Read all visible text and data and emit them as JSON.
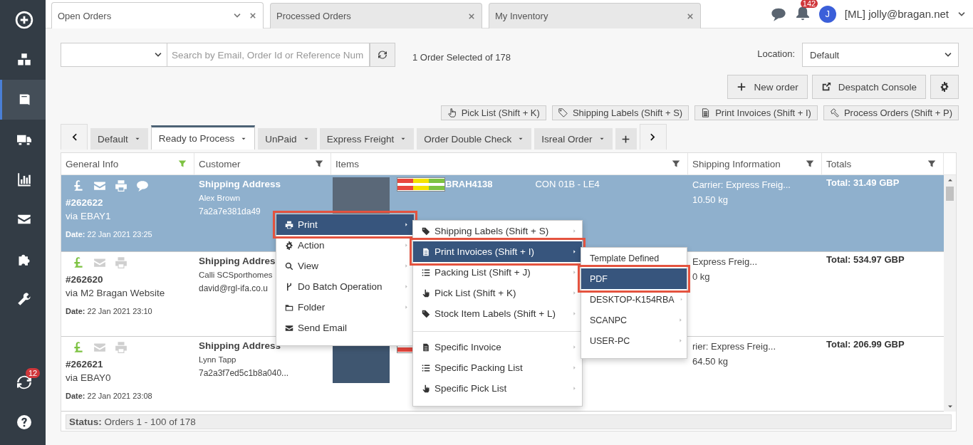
{
  "sidebar": {
    "items": [
      {
        "selected": false
      },
      {
        "selected": false
      },
      {
        "selected": true
      },
      {
        "selected": false
      },
      {
        "selected": false
      },
      {
        "selected": false
      },
      {
        "selected": false
      },
      {
        "selected": false
      },
      {
        "selected": false,
        "badge": "12"
      },
      {
        "selected": false
      }
    ]
  },
  "tabs": [
    {
      "label": "Open Orders",
      "selected": true
    },
    {
      "label": "Processed Orders",
      "selected": false
    },
    {
      "label": "My Inventory",
      "selected": false
    }
  ],
  "header": {
    "notifications_badge": "142",
    "avatar_letter": "J",
    "user": "[ML] jolly@bragan.net"
  },
  "toolbar": {
    "search_placeholder": "Search by Email, Order Id or Reference Num",
    "selection_text": "1 Order Selected of 178",
    "location_label": "Location:",
    "location_value": "Default",
    "buttons": [
      "New order",
      "Despatch Console"
    ],
    "quick_buttons": [
      "Pick List (Shift + K)",
      "Shipping Labels (Shift + S)",
      "Print Invoices (Shift + I)",
      "Process Orders (Shift + P)"
    ]
  },
  "views": [
    {
      "label": "Default",
      "selected": false
    },
    {
      "label": "Ready to Process",
      "selected": true
    },
    {
      "label": "UnPaid",
      "selected": false
    },
    {
      "label": "Express Freight",
      "selected": false
    },
    {
      "label": "Order Double Check",
      "selected": false
    },
    {
      "label": "Isreal Order",
      "selected": false
    }
  ],
  "table": {
    "columns": [
      {
        "label": "General Info",
        "filtered": true
      },
      {
        "label": "Customer",
        "filtered": false
      },
      {
        "label": "Items",
        "filtered": false
      },
      {
        "label": "Shipping Information",
        "filtered": false
      },
      {
        "label": "Totals",
        "filtered": false
      }
    ],
    "rows": [
      {
        "selected": true,
        "note": true,
        "order": "#262622",
        "channel": "via EBAY1",
        "date": "**Date:** 22 Jan 2021 23:25",
        "customer": [
          "Shipping Address",
          "Alex Brown",
          "7a2a7e381da49"
        ],
        "items": {
          "photo": true,
          "stock_bar": true,
          "sku": "BRAH4138",
          "location": "CON 01B - LE4"
        },
        "shipping": [
          "Carrier: Express Freig...",
          "10.50 kg"
        ],
        "total": "Total: 31.49 GBP"
      },
      {
        "selected": false,
        "note": false,
        "order": "#262620",
        "channel": "via M2 Bragan Website",
        "date": "**Date:** 22 Jan 2021 23:10",
        "customer": [
          "Shipping Addres",
          "Calli SCSporthomes",
          "david@rgl-ifa.co.u"
        ],
        "shipping": [
          "Express Freig...",
          "0 kg"
        ],
        "total": "Total: 534.97 GBP"
      },
      {
        "selected": false,
        "note": false,
        "order": "#262621",
        "channel": "via EBAY0",
        "date": "**Date:** 22 Jan 2021 23:08",
        "customer": [
          "Shipping Address",
          "Lynn Tapp",
          "7a2a3f7ed5c1b8a040..."
        ],
        "items": {
          "photo": true,
          "stock_bar": true
        },
        "shipping": [
          "rier: Express Freig...",
          "64.50 kg"
        ],
        "total": "Total: 206.99 GBP"
      }
    ],
    "status": "**Status:** Orders 1 - 100 of 178"
  },
  "context_menu": [
    {
      "label": "Print",
      "selected": true,
      "submenu": true
    },
    {
      "label": "Action",
      "selected": false,
      "submenu": true
    },
    {
      "label": "View",
      "selected": false,
      "submenu": true
    },
    {
      "label": "Do Batch Operation",
      "selected": false,
      "submenu": true
    },
    {
      "label": "Folder",
      "selected": false,
      "submenu": true
    },
    {
      "label": "Send Email",
      "selected": false,
      "submenu": false
    }
  ],
  "print_menu": [
    [
      {
        "label": "Shipping Labels (Shift + S)",
        "selected": false
      },
      {
        "label": "Print Invoices (Shift + I)",
        "selected": true
      },
      {
        "label": "Packing List (Shift + J)",
        "selected": false
      },
      {
        "label": "Pick List (Shift + K)",
        "selected": false
      },
      {
        "label": "Stock Item Labels (Shift + L)",
        "selected": false
      }
    ],
    [
      {
        "label": "Specific Invoice",
        "selected": false
      },
      {
        "label": "Specific Packing List",
        "selected": false
      },
      {
        "label": "Specific Pick List",
        "selected": false
      }
    ]
  ],
  "printer_menu": [
    {
      "label": "Template Defined",
      "selected": false,
      "submenu": false
    },
    {
      "label": "PDF",
      "selected": true,
      "submenu": false
    },
    {
      "label": "DESKTOP-K154RBA",
      "selected": false,
      "submenu": true
    },
    {
      "label": "SCANPC",
      "selected": false,
      "submenu": true
    },
    {
      "label": "USER-PC",
      "selected": false,
      "submenu": true
    }
  ]
}
